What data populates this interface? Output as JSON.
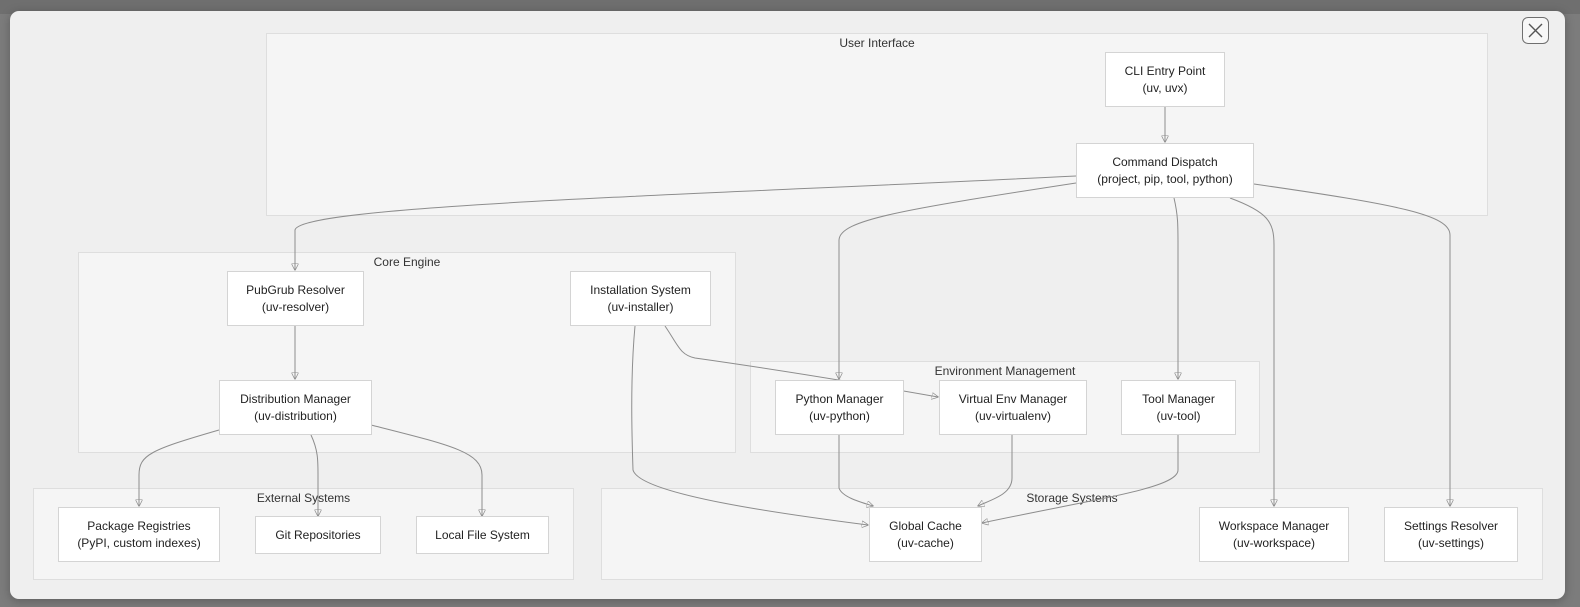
{
  "groups": {
    "ui": "User Interface",
    "core": "Core Engine",
    "env": "Environment Management",
    "ext": "External Systems",
    "storage": "Storage Systems"
  },
  "nodes": {
    "cli": {
      "title": "CLI Entry Point",
      "sub": "(uv, uvx)"
    },
    "dispatch": {
      "title": "Command Dispatch",
      "sub": "(project, pip, tool, python)"
    },
    "resolver": {
      "title": "PubGrub Resolver",
      "sub": "(uv-resolver)"
    },
    "installer": {
      "title": "Installation System",
      "sub": "(uv-installer)"
    },
    "distribution": {
      "title": "Distribution Manager",
      "sub": "(uv-distribution)"
    },
    "python": {
      "title": "Python Manager",
      "sub": "(uv-python)"
    },
    "venv": {
      "title": "Virtual Env Manager",
      "sub": "(uv-virtualenv)"
    },
    "tool": {
      "title": "Tool Manager",
      "sub": "(uv-tool)"
    },
    "registries": {
      "title": "Package Registries",
      "sub": "(PyPI, custom indexes)"
    },
    "git": {
      "title": "Git Repositories"
    },
    "localfs": {
      "title": "Local File System"
    },
    "cache": {
      "title": "Global Cache",
      "sub": "(uv-cache)"
    },
    "workspace": {
      "title": "Workspace Manager",
      "sub": "(uv-workspace)"
    },
    "settings": {
      "title": "Settings Resolver",
      "sub": "(uv-settings)"
    }
  },
  "icons": {
    "close": "close-icon"
  },
  "colors": {
    "edge": "#8d8d8d",
    "node_bg": "#ffffff",
    "group_bg": "#f5f5f5",
    "modal_bg": "#efefef"
  }
}
